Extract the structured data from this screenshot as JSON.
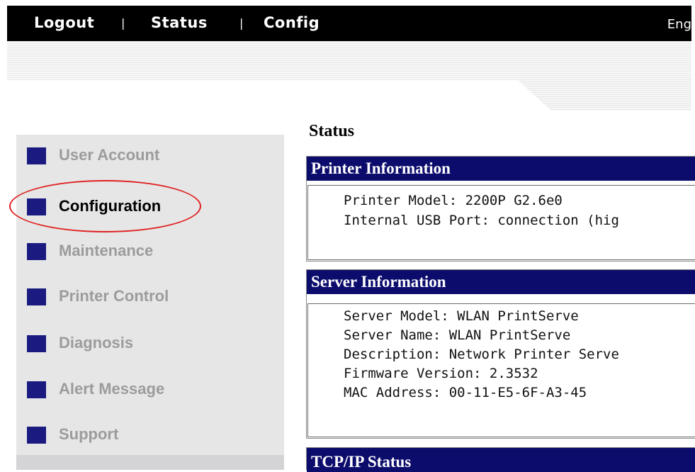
{
  "topbar": {
    "links": [
      "Logout",
      "Status",
      "Config"
    ],
    "separators": [
      "|",
      "|"
    ],
    "language": "Eng"
  },
  "sidebar": {
    "items": [
      {
        "label": "User Account",
        "active": false
      },
      {
        "label": "Configuration",
        "active": true
      },
      {
        "label": "Maintenance",
        "active": false
      },
      {
        "label": "Printer Control",
        "active": false
      },
      {
        "label": "Diagnosis",
        "active": false
      },
      {
        "label": "Alert Message",
        "active": false
      },
      {
        "label": "Support",
        "active": false
      }
    ]
  },
  "main": {
    "title": "Status",
    "printer_info": {
      "header": "Printer Information",
      "lines": [
        "Printer Model: 2200P G2.6e0",
        "Internal USB Port: connection (hig"
      ]
    },
    "server_info": {
      "header": "Server Information",
      "lines": [
        "Server Model: WLAN PrintServe",
        "Server Name: WLAN PrintServe",
        "Description: Network Printer Serve",
        "Firmware Version: 2.3532",
        "MAC Address: 00-11-E5-6F-A3-45"
      ]
    },
    "tcpip": {
      "header": "TCP/IP Status"
    }
  },
  "colors": {
    "topbar_bg": "#000000",
    "panel_header_bg": "#0c0c6c",
    "sidebar_bg": "#e6e6e6",
    "sidebar_icon": "#1a1a80",
    "highlight_circle": "#e02020"
  }
}
